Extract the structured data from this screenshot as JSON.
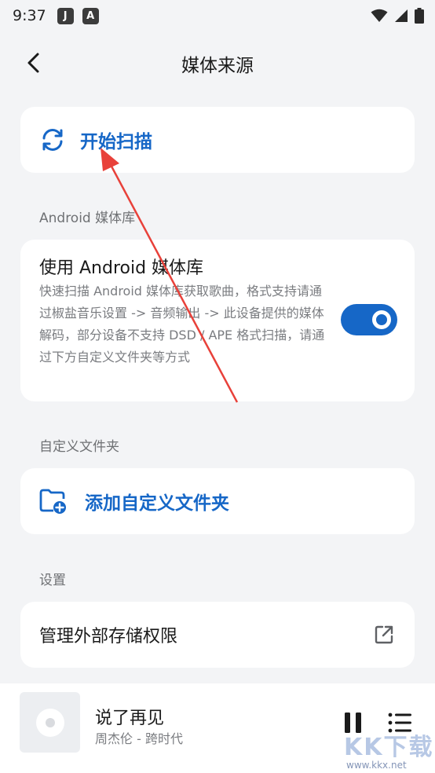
{
  "status_bar": {
    "time": "9:37",
    "notif_icons": [
      "J",
      "A"
    ]
  },
  "header": {
    "title": "媒体来源"
  },
  "scan": {
    "label": "开始扫描"
  },
  "android_section": {
    "label": "Android 媒体库",
    "title": "使用 Android 媒体库",
    "description": "快速扫描 Android 媒体库获取歌曲，格式支持请通过椒盐音乐设置 -> 音频输出 -> 此设备提供的媒体解码，部分设备不支持 DSD / APE 格式扫描，请通过下方自定义文件夹等方式",
    "toggle_on": true
  },
  "custom_section": {
    "label": "自定义文件夹",
    "add_label": "添加自定义文件夹"
  },
  "settings_section": {
    "label": "设置",
    "permission_label": "管理外部存储权限"
  },
  "player": {
    "title": "说了再见",
    "artist": "周杰伦 - 跨时代"
  },
  "watermark": {
    "logo": "KK下载",
    "url": "www.kkx.net"
  },
  "colors": {
    "accent": "#1667c7",
    "background": "#f3f4f6",
    "annotation_arrow": "#e8413a"
  }
}
